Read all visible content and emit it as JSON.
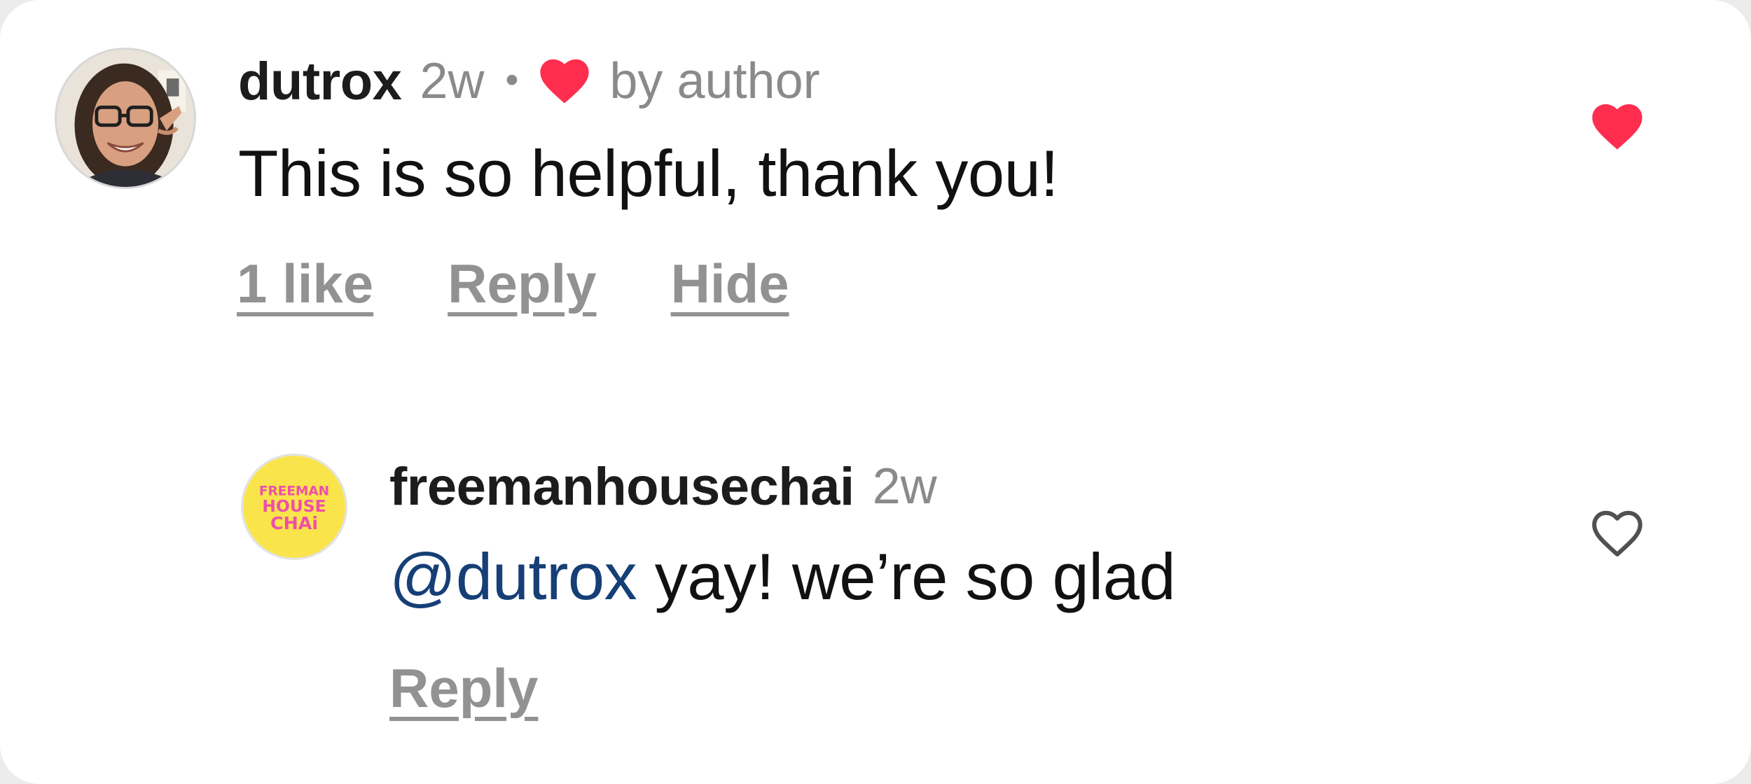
{
  "colors": {
    "heart_red": "#ff2e4f",
    "muted_gray": "#8a8a8a",
    "mention_blue": "#163f76",
    "text_black": "#111111"
  },
  "comment": {
    "avatar_icon": "user-avatar-photo",
    "username": "dutrox",
    "timestamp": "2w",
    "separator": "•",
    "author_heart_icon": "heart-filled-icon",
    "author_badge": "by author",
    "text": "This is so helpful, thank you!",
    "actions": {
      "likes": "1 like",
      "reply": "Reply",
      "hide": "Hide"
    },
    "like_icon": "heart-filled-icon",
    "liked": true
  },
  "reply": {
    "avatar_icon": "brand-logo-avatar",
    "avatar_logo_lines": [
      "FREEMAN",
      "HOUSE",
      "CHAi"
    ],
    "username": "freemanhousechai",
    "timestamp": "2w",
    "mention": "@dutrox",
    "text": " yay! we’re so glad",
    "actions": {
      "reply": "Reply"
    },
    "like_icon": "heart-outline-icon",
    "liked": false
  }
}
